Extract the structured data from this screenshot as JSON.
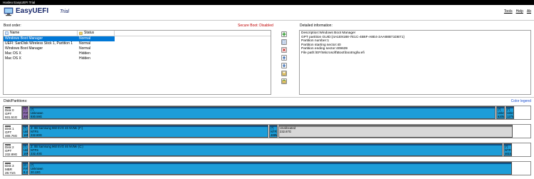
{
  "window": {
    "title": "Hasleo EasyUEFI Trial"
  },
  "header": {
    "app_name": "EasyUEFI",
    "edition": "Trial",
    "menu": [
      "Tools",
      "Help",
      "Ab"
    ]
  },
  "boot": {
    "label": "Boot order:",
    "secure_boot": "Secure Boot: Disabled",
    "columns": {
      "name": "Name",
      "status": "Status"
    },
    "entries": [
      {
        "name": "Windows Boot Manager",
        "status": "Normal"
      },
      {
        "name": "UEFI: SanDisk Wireless Stick 1, Partition 1",
        "status": "Normal"
      },
      {
        "name": "Windows Boot Manager",
        "status": "Normal"
      },
      {
        "name": "Mac OS X",
        "status": "Hidden"
      },
      {
        "name": "Mac OS X",
        "status": "Hidden"
      }
    ]
  },
  "toolbar": {
    "icons": [
      "add-entry-icon",
      "edit-entry-icon",
      "delete-entry-icon",
      "move-up-icon",
      "move-down-icon",
      "backup-icon",
      "restore-icon"
    ]
  },
  "details": {
    "label": "Detailed information:",
    "lines": [
      "Description:Windows Boot Manager",
      "GPT partition GUID:{4A1E9188-7E1C-4B6F-A8E4-2AA88B71DB71}",
      "Partition number:1",
      "Partition starting sector:40",
      "Partition ending sector:409639",
      "File path:\\EFI\\Microsoft\\Boot\\bootmgfw.efi"
    ]
  },
  "disks": {
    "label": "Disk/Partitions:",
    "legend": "Color legend",
    "list": [
      {
        "info": {
          "name": "Disk 0",
          "type": "GPT",
          "size": "931.51G"
        },
        "partitions": [
          {
            "l1": "(*)",
            "l2": "FAT32",
            "l3": "200M",
            "color": "purple",
            "width": 9
          },
          {
            "l1": "(*)",
            "l2": "Unknown",
            "l3": "930.59G",
            "color": "cyan",
            "width": 655
          },
          {
            "l1": "(*)",
            "l2": "Unknown",
            "l3": "620M",
            "color": "cyan",
            "width": 12
          },
          {
            "l1": "(*)",
            "l2": "Unknown",
            "l3": "127M",
            "color": "cyan",
            "width": 12
          }
        ]
      },
      {
        "info": {
          "name": "Disk 1",
          "type": "GPT",
          "size": "465.76G"
        },
        "partitions": [
          {
            "l1": "(*)",
            "l2": "Unknown",
            "l3": "16M",
            "color": "cyan",
            "width": 9
          },
          {
            "l1": "Z: 0B Samsung 960 EVO 46 NVMe (F:)",
            "l2": "NTFS",
            "l3": "232.80G",
            "color": "cyan",
            "width": 336
          },
          {
            "l1": "(*)",
            "l2": "NTFS",
            "l3": "489M",
            "color": "cyan",
            "width": 12
          },
          {
            "l1": "Unallocated",
            "l2": "232.87G",
            "l3": "",
            "color": "unalloc",
            "width": 329
          }
        ]
      },
      {
        "info": {
          "name": "Disk 2",
          "type": "GPT",
          "size": "232.89G"
        },
        "partitions": [
          {
            "l1": "(*)",
            "l2": "Unknown",
            "l3": "16M",
            "color": "cyan",
            "width": 9
          },
          {
            "l1": "Z: 0B Samsung 960 EVO 46 NVMe (C:)",
            "l2": "NTFS",
            "l3": "232.40G",
            "color": "cyan",
            "width": 665
          },
          {
            "l1": "(*)",
            "l2": "NTFS",
            "l3": "461M",
            "color": "cyan",
            "width": 12
          }
        ]
      },
      {
        "info": {
          "name": "Disk 3",
          "type": "MBR",
          "size": "28.71G"
        },
        "partitions": [
          {
            "l1": "(C:)OVER",
            "l2": "FAT32",
            "l3": "8.25G",
            "color": "cyan",
            "width": 9
          },
          {
            "l1": "(*)",
            "l2": "Unknown",
            "l3": "20.13G",
            "color": "cyan",
            "width": 678
          }
        ]
      }
    ]
  },
  "colors": {
    "partition_cyan": "#1d9dd8",
    "partition_purple": "#8e6bb2",
    "unallocated": "#d8d8d8",
    "selection": "#0078d7",
    "secure_boot_text": "#c00000",
    "legend_link": "#1a4fd0"
  }
}
